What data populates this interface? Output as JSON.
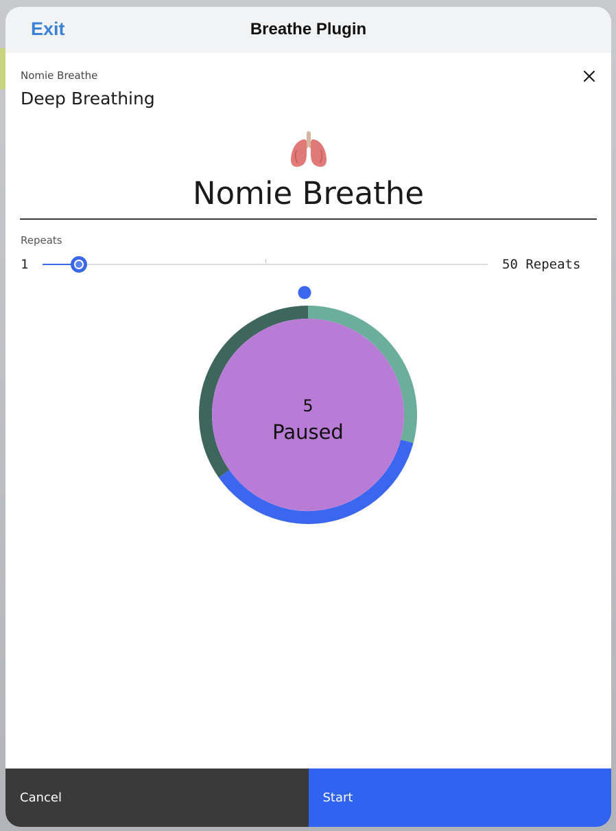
{
  "navbar": {
    "exit_label": "Exit",
    "title": "Breathe Plugin"
  },
  "plugin": {
    "name": "Nomie Breathe",
    "subtitle": "Deep Breathing",
    "close_icon": "close-icon"
  },
  "hero": {
    "emoji": "lungs-icon",
    "title": "Nomie Breathe"
  },
  "repeats": {
    "label": "Repeats",
    "min_label": "1",
    "max_label": "50 Repeats",
    "min": 1,
    "max": 50,
    "value": 5
  },
  "breath": {
    "count": "5",
    "status": "Paused",
    "colors": {
      "inner": "#b97cd6",
      "segment_inhale": "#6aae9b",
      "segment_hold": "#3b66f0",
      "segment_exhale": "#3f665d",
      "marker": "#3b66f0"
    }
  },
  "footer": {
    "cancel_label": "Cancel",
    "start_label": "Start"
  },
  "colors": {
    "accent": "#3a82d6",
    "primary": "#2f63f0",
    "dark": "#3a3a3a"
  }
}
